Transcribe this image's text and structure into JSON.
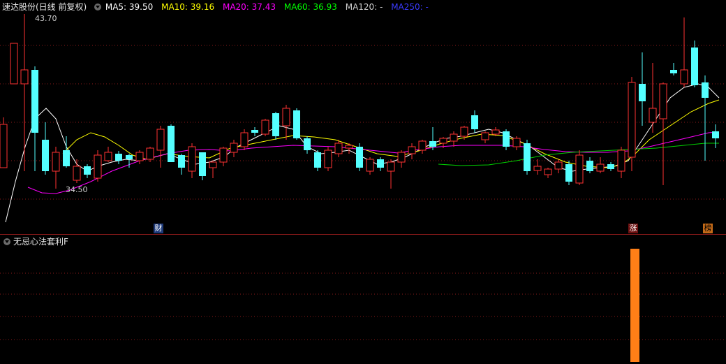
{
  "header": {
    "stock_title": "速达股份(日线 前复权)",
    "ma_items": [
      {
        "label": "MA5: 39.50",
        "color": "#ffffff"
      },
      {
        "label": "MA10: 39.16",
        "color": "#ffff00"
      },
      {
        "label": "MA20: 37.43",
        "color": "#ff00ff"
      },
      {
        "label": "MA60: 36.93",
        "color": "#00ff00"
      },
      {
        "label": "MA120: -",
        "color": "#cfcfcf"
      },
      {
        "label": "MA250: -",
        "color": "#3a3aff"
      }
    ]
  },
  "sub_panel": {
    "title": "无忌心法套利F"
  },
  "annotations": {
    "high_label": "43.70",
    "low_label": "34.50"
  },
  "events": {
    "cai": "财",
    "zhang": "涨",
    "bang": "榜"
  },
  "colors": {
    "up": "#ff3232",
    "down": "#54ffff",
    "grid": "#8a1a1a",
    "signal_bar": "#ff7f17"
  },
  "chart_data": {
    "type": "bar",
    "title": "",
    "series": [
      {
        "name": "MA5",
        "last": 39.5
      },
      {
        "name": "MA10",
        "last": 39.16
      },
      {
        "name": "MA20",
        "last": 37.43
      },
      {
        "name": "MA60",
        "last": 36.93
      }
    ],
    "high": 43.7,
    "low": 34.5
  }
}
